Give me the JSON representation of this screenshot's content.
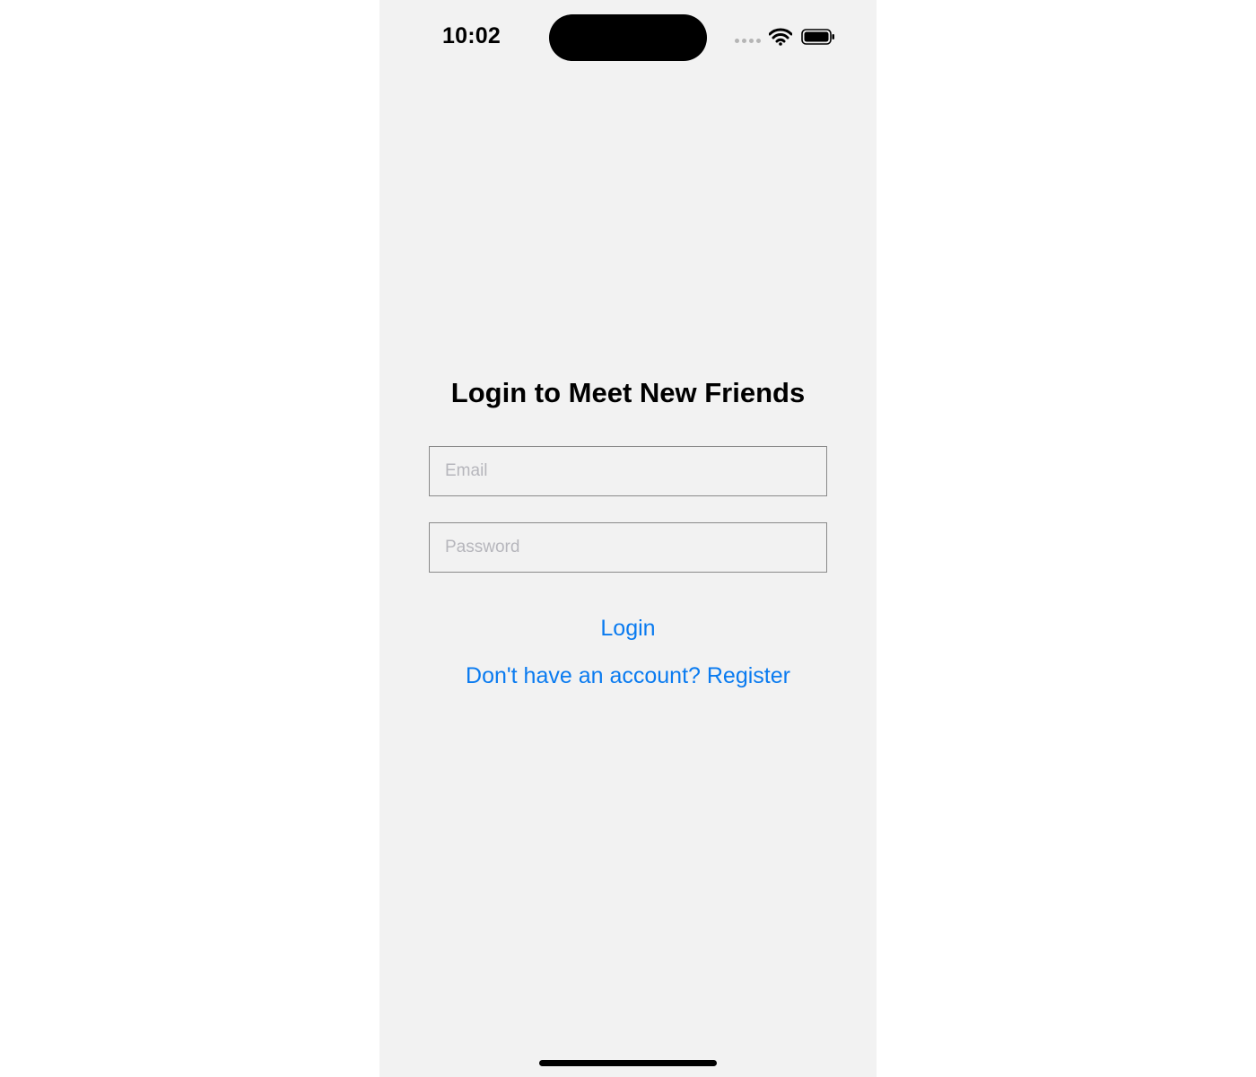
{
  "status_bar": {
    "time": "10:02",
    "icons": [
      "cellular-signal-icon",
      "wifi-icon",
      "battery-icon"
    ]
  },
  "login_screen": {
    "title": "Login to Meet New Friends",
    "email_field": {
      "value": "",
      "placeholder": "Email"
    },
    "password_field": {
      "value": "",
      "placeholder": "Password"
    },
    "login_button_label": "Login",
    "register_link_label": "Don't have an account? Register"
  },
  "colors": {
    "background": "#f2f2f2",
    "accent": "#0a7bf0",
    "text": "#000000",
    "placeholder": "#b6b6bc",
    "field_border": "#8a8a8a"
  }
}
